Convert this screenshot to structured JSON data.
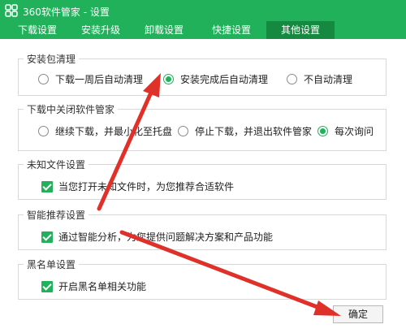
{
  "window": {
    "title": "360软件管家 - 设置",
    "icon": "grid-logo-icon"
  },
  "tabs": [
    {
      "label": "下载设置",
      "active": false
    },
    {
      "label": "安装升级",
      "active": false
    },
    {
      "label": "卸载设置",
      "active": false
    },
    {
      "label": "快捷设置",
      "active": false
    },
    {
      "label": "其他设置",
      "active": true
    }
  ],
  "sections": {
    "cleanup": {
      "title": "安装包清理",
      "options": [
        {
          "label": "下载一周后自动清理",
          "selected": false
        },
        {
          "label": "安装完成后自动清理",
          "selected": true
        },
        {
          "label": "不自动清理",
          "selected": false
        }
      ]
    },
    "close_during_download": {
      "title": "下载中关闭软件管家",
      "options": [
        {
          "label": "继续下载，并最小化至托盘",
          "selected": false
        },
        {
          "label": "停止下载，并退出软件管家",
          "selected": false
        },
        {
          "label": "每次询问",
          "selected": true
        }
      ]
    },
    "unknown_files": {
      "title": "未知文件设置",
      "checkbox": {
        "label": "当您打开未知文件时，为您推荐合适软件",
        "checked": true
      }
    },
    "smart_recommend": {
      "title": "智能推荐设置",
      "checkbox": {
        "label": "通过智能分析，为您提供问题解决方案和产品功能",
        "checked": true
      }
    },
    "blacklist": {
      "title": "黑名单设置",
      "checkbox": {
        "label": "开启黑名单相关功能",
        "checked": true
      }
    }
  },
  "footer": {
    "ok_label": "确定"
  },
  "colors": {
    "brand": "#20b15a",
    "active_tab": "#14893f",
    "annotation_arrow": "#e0302a"
  }
}
